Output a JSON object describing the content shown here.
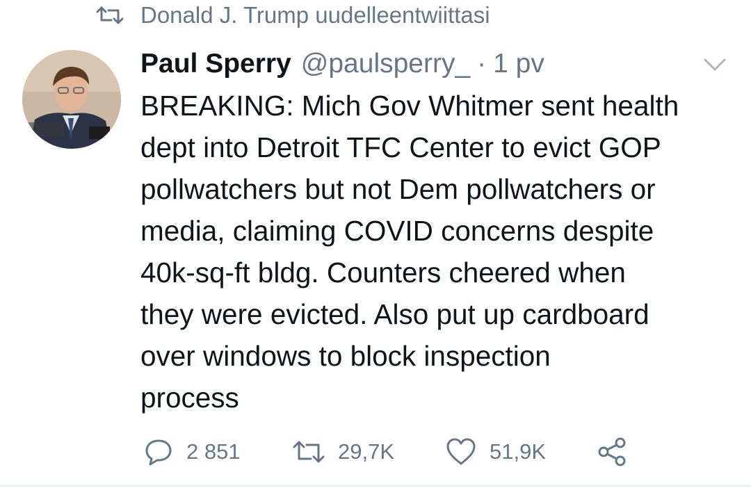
{
  "retweet_context": {
    "icon": "retweet-icon",
    "text": "Donald J. Trump uudelleentwiittasi"
  },
  "tweet": {
    "author": {
      "name": "Paul Sperry",
      "handle": "@paulsperry_",
      "avatar": "avatar-photo"
    },
    "separator": "·",
    "time": "1 pv",
    "caret_icon": "chevron-down-icon",
    "text_lines": [
      "BREAKING: Mich Gov Whitmer sent health",
      "dept into Detroit TFC Center to evict GOP",
      "pollwatchers but not Dem pollwatchers or",
      "media, claiming COVID concerns despite",
      "40k-sq-ft bldg. Counters cheered when",
      "they were evicted. Also put up cardboard",
      "over windows to block inspection",
      "process"
    ],
    "actions": {
      "reply": {
        "icon": "reply-icon",
        "count": "2 851"
      },
      "retweet": {
        "icon": "retweet-icon",
        "count": "29,7K"
      },
      "like": {
        "icon": "heart-icon",
        "count": "51,9K"
      },
      "share": {
        "icon": "share-icon"
      }
    }
  },
  "colors": {
    "text": "#0f1419",
    "secondary": "#657786",
    "background": "#ffffff"
  }
}
